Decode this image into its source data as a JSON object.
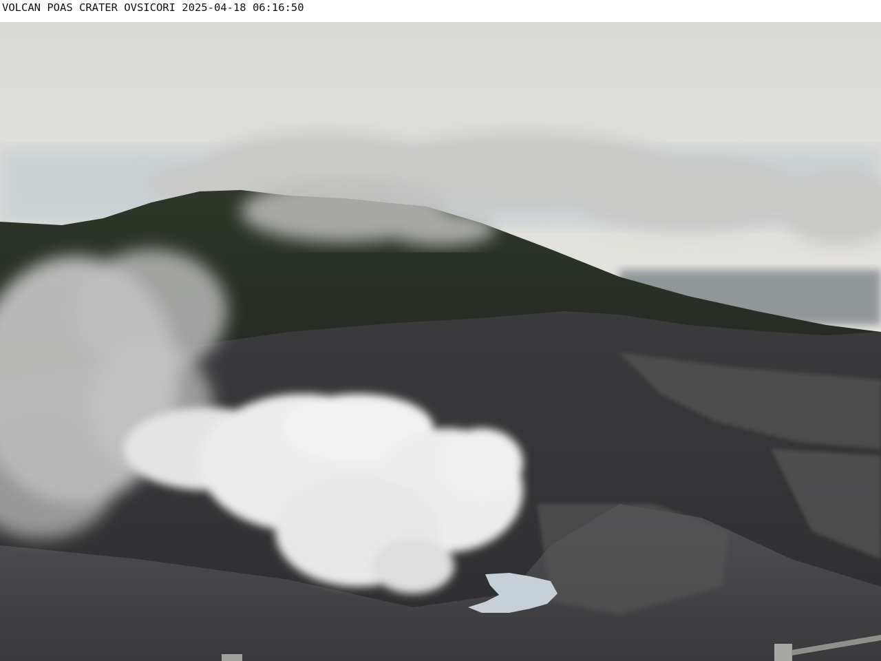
{
  "caption": {
    "text": "VOLCAN POAS CRATER OVSICORI 2025-04-18 06:16:50"
  },
  "scene": {
    "description_colors": {
      "sky": "#dcdcd8",
      "cloud": "#c8c8c6",
      "mountain": "#2b3326",
      "crater_wall": "#3e3e40",
      "crater_floor": "#4a4a4c",
      "plume": "#e6e6e6",
      "lake": "#c9d2d8"
    }
  }
}
